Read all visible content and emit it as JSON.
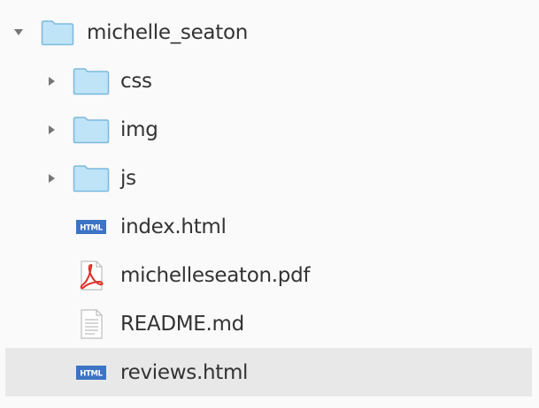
{
  "tree": {
    "root": {
      "label": "michelle_seaton",
      "expanded": true,
      "icon": "folder-icon"
    },
    "children": [
      {
        "label": "css",
        "type": "folder",
        "icon": "folder-icon",
        "expanded": false
      },
      {
        "label": "img",
        "type": "folder",
        "icon": "folder-icon",
        "expanded": false
      },
      {
        "label": "js",
        "type": "folder",
        "icon": "folder-icon",
        "expanded": false
      },
      {
        "label": "index.html",
        "type": "file",
        "icon": "html-file-icon",
        "badge": "HTML"
      },
      {
        "label": "michelleseaton.pdf",
        "type": "file",
        "icon": "pdf-file-icon"
      },
      {
        "label": "README.md",
        "type": "file",
        "icon": "text-file-icon"
      },
      {
        "label": "reviews.html",
        "type": "file",
        "icon": "html-file-icon",
        "badge": "HTML",
        "selected": true
      }
    ]
  },
  "colors": {
    "folder_fill": "#bfe3f7",
    "folder_stroke": "#7cb9de",
    "html_badge": "#3b74c4",
    "pdf_red": "#e0312b",
    "selected_bg": "#e8e8e8",
    "text": "#333333"
  }
}
